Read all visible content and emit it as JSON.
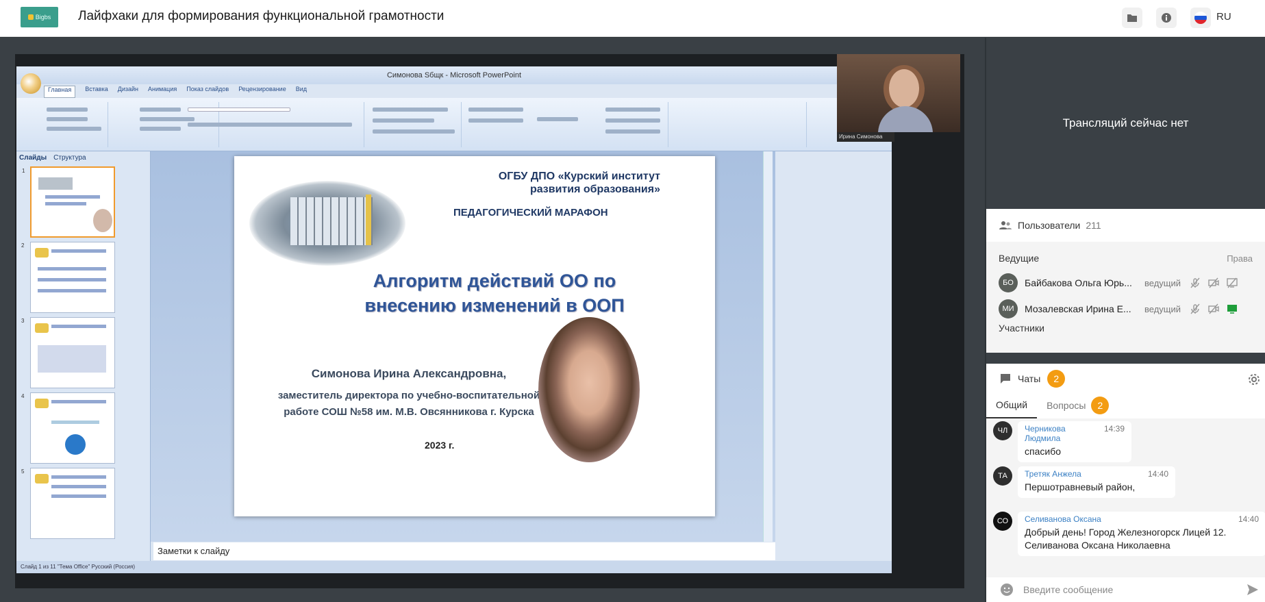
{
  "header": {
    "logo_text": "Bigbs",
    "title": "Лайфхаки для формирования функциональной грамотности",
    "lang": "RU"
  },
  "presentation": {
    "window_title": "Симонова Sбщк - Microsoft PowerPoint",
    "tabs": [
      "Главная",
      "Вставка",
      "Дизайн",
      "Анимация",
      "Показ слайдов",
      "Рецензирование",
      "Вид"
    ],
    "left_tabs": [
      "Слайды",
      "Структура"
    ],
    "notes_label": "Заметки к слайду",
    "status": "Слайд 1 из 11    \"Тема Office\"    Русский (Россия)",
    "webcam_label": "Ирина Симонова",
    "slide": {
      "org_line1": "ОГБУ ДПО «Курский институт",
      "org_line2": "развития образования»",
      "marathon": "ПЕДАГОГИЧЕСКИЙ МАРАФОН",
      "heading_line1": "Алгоритм действий ОО по",
      "heading_line2": "внесению изменений в ООП",
      "name": "Симонова Ирина Александровна,",
      "position_line1": "заместитель директора по учебно-воспитательной",
      "position_line2": "работе СОШ №58 им. М.В. Овсянникова г. Курска",
      "year": "2023 г."
    }
  },
  "stream": {
    "no_stream_text": "Трансляций сейчас нет"
  },
  "users": {
    "label": "Пользователи",
    "count": "211",
    "hosts_label": "Ведущие",
    "rights_label": "Права",
    "participants_label": "Участники",
    "hosts": [
      {
        "initials": "БО",
        "name": "Байбакова Ольга Юрь...",
        "role": "ведущий",
        "screen_color": "#999999"
      },
      {
        "initials": "МИ",
        "name": "Мозалевская Ирина Е...",
        "role": "ведущий",
        "screen_color": "#1e9e3a"
      }
    ]
  },
  "chat": {
    "label": "Чаты",
    "badge": "2",
    "tabs": {
      "general": "Общий",
      "questions": "Вопросы",
      "questions_badge": "2"
    },
    "messages": [
      {
        "initials": "ЧЛ",
        "author": "Черникова Людмила",
        "time": "14:39",
        "text": "спасибо"
      },
      {
        "initials": "ТА",
        "author": "Третяк Анжела",
        "time": "14:40",
        "text": "Першотравневый район,"
      },
      {
        "initials": "СО",
        "author": "Селиванова Оксана",
        "time": "14:40",
        "text": "Добрый день! Город Железногорск Лицей 12. Селиванова Оксана Николаевна"
      }
    ],
    "placeholder": "Введите сообщение"
  }
}
